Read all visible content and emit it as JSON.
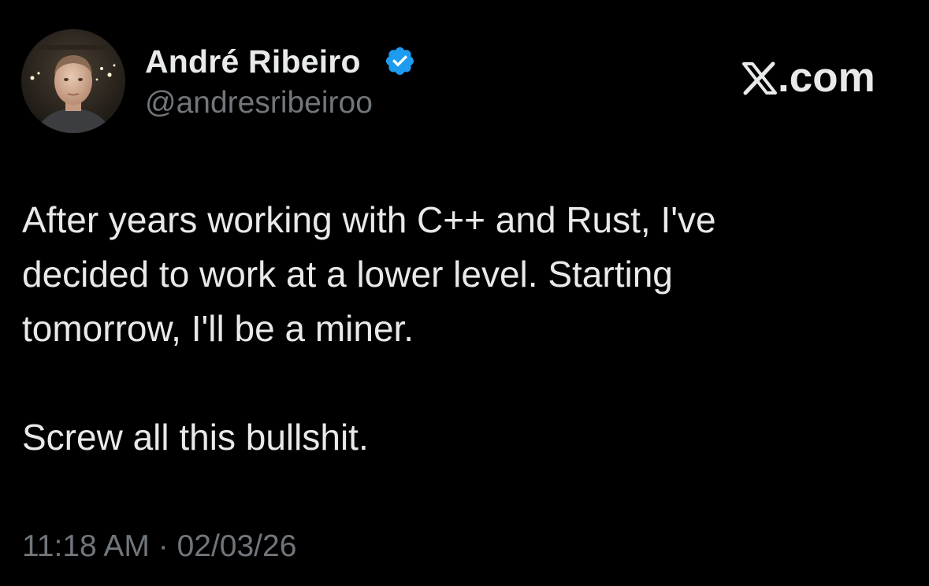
{
  "author": {
    "display_name": "André Ribeiro",
    "handle": "@andresribeiroo",
    "verified": true,
    "verified_icon": "verified-badge-icon",
    "verified_color": "#1d9bf0"
  },
  "brand": {
    "icon": "x-logo-icon",
    "suffix": ".com"
  },
  "tweet": {
    "paragraph_1_line_1": "After years working with C++ and Rust, I've",
    "paragraph_1_line_2": "decided to work at a lower level. Starting",
    "paragraph_1_line_3": "tomorrow, I'll be a miner.",
    "paragraph_2": "Screw all this bullshit."
  },
  "meta": {
    "time": "11:18 AM",
    "separator": "·",
    "date": "02/03/26"
  },
  "colors": {
    "background": "#000000",
    "primary_text": "#e7e9ea",
    "secondary_text": "#71767b",
    "accent": "#1d9bf0"
  }
}
